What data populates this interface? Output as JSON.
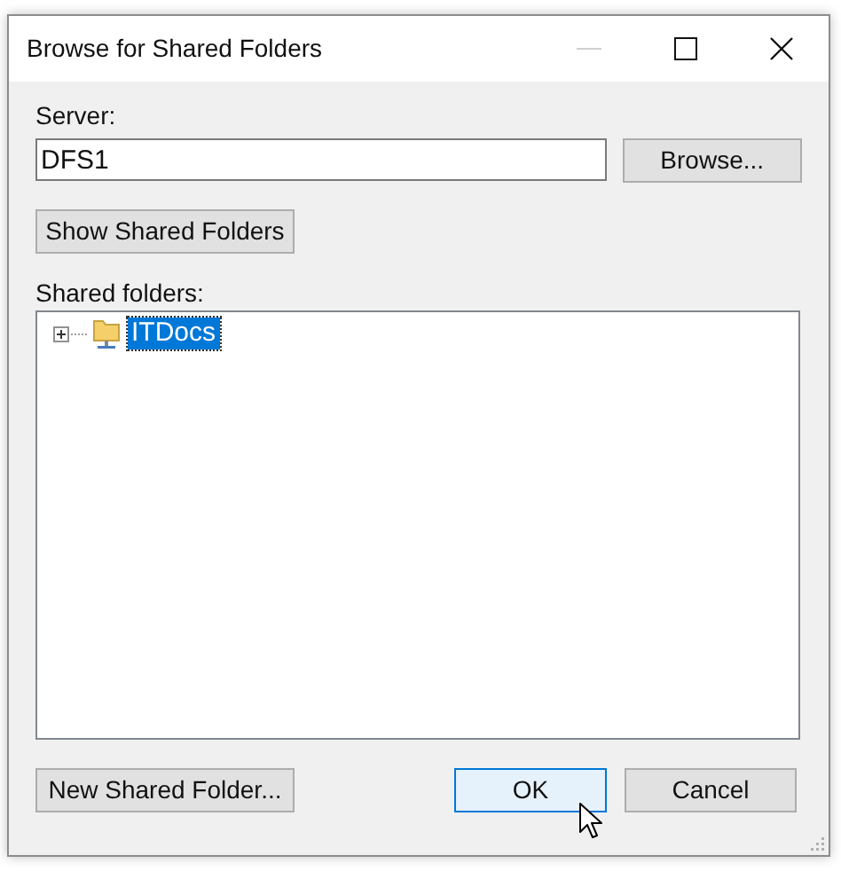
{
  "window": {
    "title": "Browse for Shared Folders",
    "title_buttons": [
      {
        "kind": "minimize",
        "disabled": true
      },
      {
        "kind": "maximize",
        "disabled": false
      },
      {
        "kind": "close",
        "disabled": false
      }
    ]
  },
  "server": {
    "label": "Server:",
    "value": "DFS1",
    "browse_button": "Browse..."
  },
  "show_button": "Show Shared Folders",
  "tree": {
    "label": "Shared folders:",
    "items": [
      {
        "label": "ITDocs",
        "expanded": false,
        "selected": true
      }
    ]
  },
  "buttons": [
    {
      "label": "New Shared Folder...",
      "default": false
    },
    {
      "label": "OK",
      "default": true
    },
    {
      "label": "Cancel",
      "default": false
    }
  ]
}
